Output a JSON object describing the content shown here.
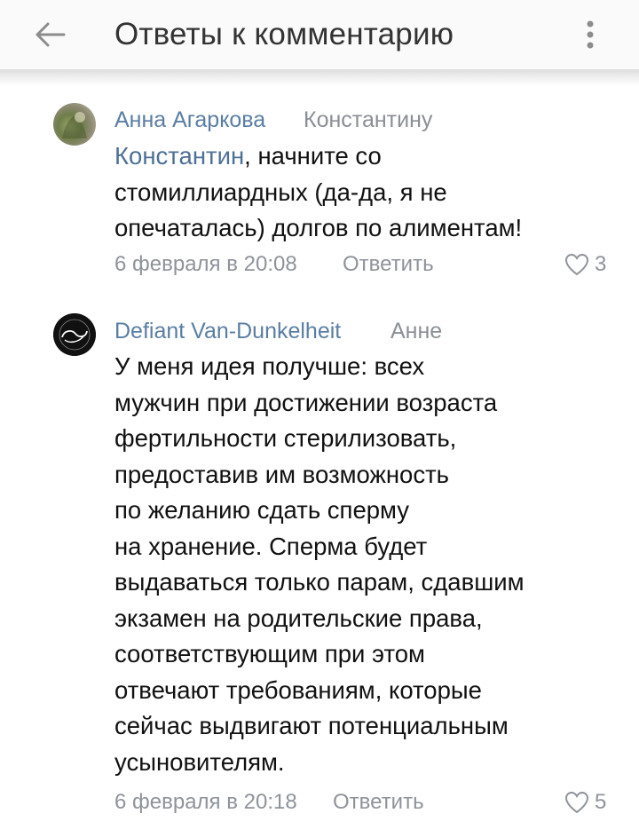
{
  "header": {
    "back_icon": "arrow-left-icon",
    "title": "Ответы к комментарию",
    "menu_icon": "more-vertical-icon"
  },
  "comments": [
    {
      "author": "Анна Агаркова",
      "reply_to": "Константину",
      "mention": "Константин",
      "text": ", начните со\nстомиллиардных (да-да, я не\nопечаталась) долгов по алиментам!",
      "timestamp": "6 февраля в 20:08",
      "reply_label": "Ответить",
      "likes": "3",
      "avatar_icon": "user-photo-avatar"
    },
    {
      "author": "Defiant Van-Dunkelheit",
      "reply_to": "Анне",
      "text": "У меня идея получше: всех\nмужчин при достижении возраста\nфертильности стерилизовать,\nпредоставив им возможность\nпо желанию сдать сперму\nна хранение. Сперма будет\nвыдаваться только парам, сдавшим\nэкзамен на родительские права,\nсоответствующим при этом\nотвечают требованиям, которые\nсейчас выдвигают потенциальным\nусыновителям.",
      "timestamp": "6 февраля в 20:18",
      "reply_label": "Ответить",
      "likes": "5",
      "avatar_icon": "logo-avatar"
    }
  ],
  "colors": {
    "author": "#5a7ea3",
    "mention": "#4e7096",
    "meta": "#8e939a",
    "header_bg": "#fafafa"
  }
}
